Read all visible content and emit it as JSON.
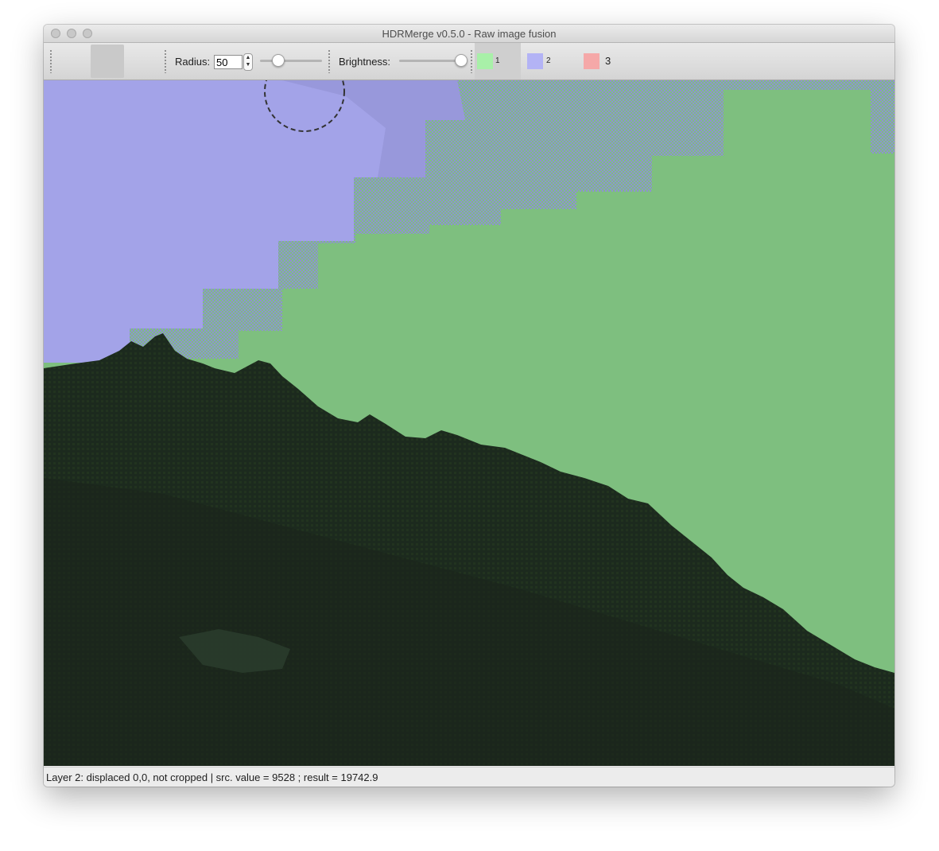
{
  "window": {
    "title": "HDRMerge v0.5.0 - Raw image fusion"
  },
  "toolbar": {
    "radius_label": "Radius:",
    "radius_value": "50",
    "radius_slider_level": 0.3,
    "brightness_label": "Brightness:",
    "brightness_slider_level": 1.0,
    "layers": [
      {
        "number": "1",
        "color": "#a8f0a8",
        "selected": true
      },
      {
        "number": "2",
        "color": "#b3b3f5",
        "selected": false
      },
      {
        "number": "3",
        "color": "#f5a8a8",
        "selected": false
      }
    ]
  },
  "canvas": {
    "sky_layer1_color": "#7ebf7f",
    "sky_layer2_color": "#a3a3e8",
    "hill_color": "#1c2a1e"
  },
  "status": {
    "text": "Layer 2: displaced 0,0, not cropped | src. value = 9528 ; result = 19742.9"
  }
}
